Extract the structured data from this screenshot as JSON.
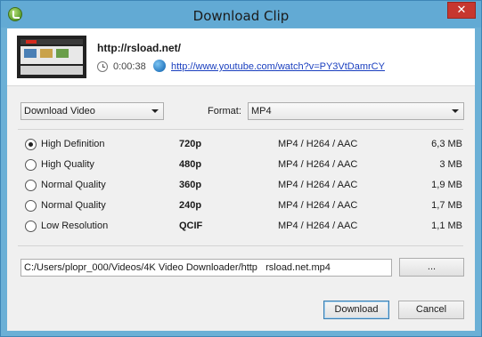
{
  "window": {
    "title": "Download Clip",
    "close_label": "✕"
  },
  "clip": {
    "title": "http://rsload.net/",
    "duration": "0:00:38",
    "url": "http://www.youtube.com/watch?v=PY3VtDamrCY"
  },
  "controls": {
    "mode_select": "Download Video",
    "format_label": "Format:",
    "format_select": "MP4"
  },
  "qualities": [
    {
      "name": "High Definition",
      "resolution": "720p",
      "format": "MP4 / H264 / AAC",
      "size": "6,3 MB",
      "selected": true
    },
    {
      "name": "High Quality",
      "resolution": "480p",
      "format": "MP4 / H264 / AAC",
      "size": "3 MB",
      "selected": false
    },
    {
      "name": "Normal Quality",
      "resolution": "360p",
      "format": "MP4 / H264 / AAC",
      "size": "1,9 MB",
      "selected": false
    },
    {
      "name": "Normal Quality",
      "resolution": "240p",
      "format": "MP4 / H264 / AAC",
      "size": "1,7 MB",
      "selected": false
    },
    {
      "name": "Low Resolution",
      "resolution": "QCIF",
      "format": "MP4 / H264 / AAC",
      "size": "1,1 MB",
      "selected": false
    }
  ],
  "output": {
    "path": "C:/Users/plopr_000/Videos/4K Video Downloader/http   rsload.net.mp4",
    "browse_label": "..."
  },
  "buttons": {
    "download_label": "Download",
    "cancel_label": "Cancel"
  }
}
